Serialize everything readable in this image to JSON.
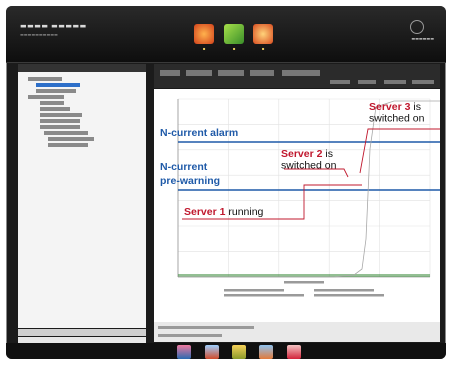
{
  "chart_data": {
    "type": "line",
    "annotations": [
      {
        "bold": "N-current alarm",
        "rest": ""
      },
      {
        "bold": "N-current",
        "rest": "pre-warning"
      },
      {
        "bold": "Server 1",
        "rest": " running"
      },
      {
        "bold": "Server 2",
        "rest": " is",
        "rest2": "switched on"
      },
      {
        "bold": "Server 3",
        "rest": " is",
        "rest2": "switched on"
      }
    ],
    "thresholds": {
      "alarm_color": "#1f5aa8",
      "prewarning_color": "#1f5aa8"
    },
    "series_color": "#c0182e",
    "grid": true
  },
  "colors": {
    "chart_bg": "#ffffff",
    "chrome": "#1b1b1b",
    "accent_red": "#c0182e",
    "accent_blue": "#1f5aa8"
  }
}
